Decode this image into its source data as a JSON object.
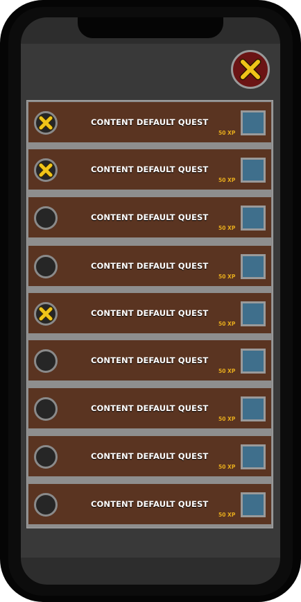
{
  "colors": {
    "accent_check": "#f0c419",
    "close_bg": "#6b1414",
    "row_bg": "#5a3421",
    "reward_bg": "#3f6f8c",
    "xp_text": "#e7ac1c"
  },
  "header": {
    "close_icon": "close-icon"
  },
  "quests": [
    {
      "title": "CONTENT DEFAULT QUEST",
      "xp": "50 XP",
      "completed": true
    },
    {
      "title": "CONTENT DEFAULT QUEST",
      "xp": "50 XP",
      "completed": true
    },
    {
      "title": "CONTENT DEFAULT QUEST",
      "xp": "50 XP",
      "completed": false
    },
    {
      "title": "CONTENT DEFAULT QUEST",
      "xp": "50 XP",
      "completed": false
    },
    {
      "title": "CONTENT DEFAULT QUEST",
      "xp": "50 XP",
      "completed": true
    },
    {
      "title": "CONTENT DEFAULT QUEST",
      "xp": "50 XP",
      "completed": false
    },
    {
      "title": "CONTENT DEFAULT QUEST",
      "xp": "50 XP",
      "completed": false
    },
    {
      "title": "CONTENT DEFAULT QUEST",
      "xp": "50 XP",
      "completed": false
    },
    {
      "title": "CONTENT DEFAULT QUEST",
      "xp": "50 XP",
      "completed": false
    }
  ]
}
